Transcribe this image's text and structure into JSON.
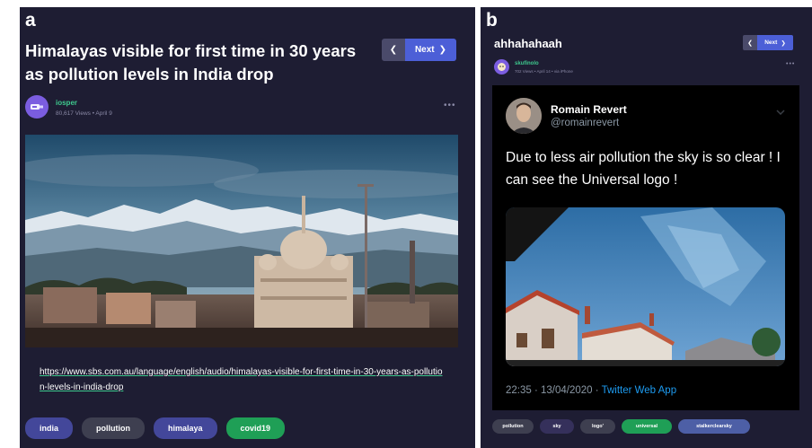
{
  "panel_a": {
    "letter": "a",
    "title": "Himalayas visible for first time in 30 years as pollution levels in India drop",
    "nav": {
      "prev_icon": "chevron-left",
      "next_label": "Next"
    },
    "author": {
      "name": "iosper",
      "meta": "80,617 Views • April 9"
    },
    "link": "https://www.sbs.com.au/language/english/audio/himalayas-visible-for-first-time-in-30-years-as-pollution-levels-in-india-drop",
    "tags": [
      "india",
      "pollution",
      "himalaya",
      "covid19"
    ]
  },
  "panel_b": {
    "letter": "b",
    "title": "ahhahahaah",
    "nav": {
      "prev_icon": "chevron-left",
      "next_label": "Next"
    },
    "author": {
      "name": "skufinolo",
      "meta": "702 Views • April 14 • via iPhone"
    },
    "tweet": {
      "name": "Romain Revert",
      "handle": "@romainrevert",
      "text": "Due to less air pollution the sky is so clear ! I can see the Universal logo !",
      "time": "22:35 · 13/04/2020 · ",
      "source": "Twitter Web App"
    },
    "tags": [
      "pollution",
      "sky",
      "logo'",
      "universal",
      "stalkerclearsky"
    ]
  },
  "colors": {
    "panel_bg": "#1e1d33",
    "accent_green": "#3ec98e",
    "next_button": "#4c5fd7",
    "tweet_bg": "#000000",
    "twitter_blue": "#1d9bf0"
  }
}
